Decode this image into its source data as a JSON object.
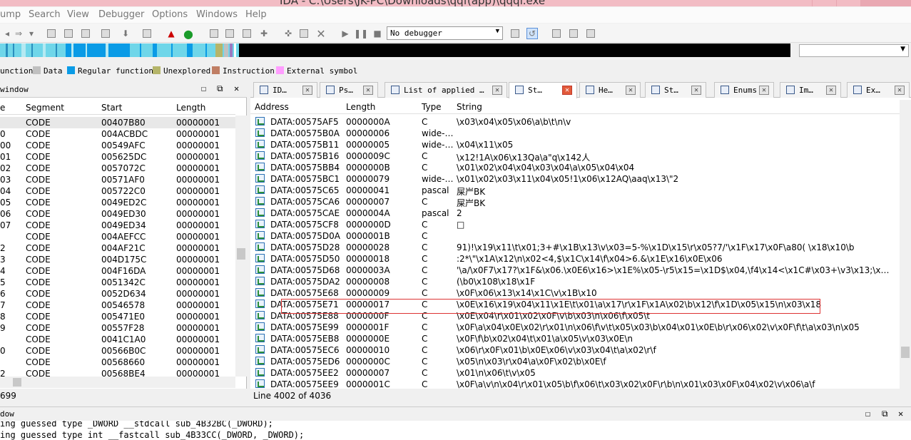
{
  "title": "IDA - C:\\Users\\JK-PC\\Downloads\\qqf(app)\\qqqf.exe",
  "menu": [
    "ump",
    "Search",
    "View",
    "Debugger",
    "Options",
    "Windows",
    "Help"
  ],
  "toolbar": {
    "debugger_select": "No debugger"
  },
  "legend": [
    {
      "label": "unction",
      "color": "#ffffff"
    },
    {
      "label": "Data",
      "color": "#c0c0c0"
    },
    {
      "label": "Regular function",
      "color": "#0a9be6"
    },
    {
      "label": "Unexplored",
      "color": "#b5b56a"
    },
    {
      "label": "Instruction",
      "color": "#c07e64"
    },
    {
      "label": "External symbol",
      "color": "#ff9eff"
    }
  ],
  "left_pane": {
    "title": "window",
    "columns": [
      "e",
      "Segment",
      "Start",
      "Length"
    ],
    "rows": [
      [
        "",
        "CODE",
        "00407B80",
        "00000001"
      ],
      [
        "0",
        "CODE",
        "004ACBDC",
        "00000001"
      ],
      [
        "00",
        "CODE",
        "00549AFC",
        "00000001"
      ],
      [
        "01",
        "CODE",
        "005625DC",
        "00000001"
      ],
      [
        "02",
        "CODE",
        "0057072C",
        "00000001"
      ],
      [
        "03",
        "CODE",
        "00571AF0",
        "00000001"
      ],
      [
        "04",
        "CODE",
        "005722C0",
        "00000001"
      ],
      [
        "05",
        "CODE",
        "0049ED2C",
        "00000001"
      ],
      [
        "06",
        "CODE",
        "0049ED30",
        "00000001"
      ],
      [
        "07",
        "CODE",
        "0049ED34",
        "00000001"
      ],
      [
        "",
        "CODE",
        "004AEFCC",
        "00000001"
      ],
      [
        "2",
        "CODE",
        "004AF21C",
        "00000001"
      ],
      [
        "3",
        "CODE",
        "004D175C",
        "00000001"
      ],
      [
        "4",
        "CODE",
        "004F16DA",
        "00000001"
      ],
      [
        "5",
        "CODE",
        "0051342C",
        "00000001"
      ],
      [
        "6",
        "CODE",
        "0052D634",
        "00000001"
      ],
      [
        "7",
        "CODE",
        "00546578",
        "00000001"
      ],
      [
        "8",
        "CODE",
        "005471E0",
        "00000001"
      ],
      [
        "9",
        "CODE",
        "00557F28",
        "00000001"
      ],
      [
        "",
        "CODE",
        "0041C1A0",
        "00000001"
      ],
      [
        "0",
        "CODE",
        "00566B0C",
        "00000001"
      ],
      [
        "",
        "CODE",
        "00568660",
        "00000001"
      ],
      [
        "2",
        "CODE",
        "00568BE4",
        "00000001"
      ]
    ],
    "status": "699"
  },
  "tabs": [
    {
      "label": "ID…",
      "active": false
    },
    {
      "label": "Ps…",
      "active": false
    },
    {
      "label": "List of applied …",
      "active": false
    },
    {
      "label": "St…",
      "active": true
    },
    {
      "label": "He…",
      "active": false
    },
    {
      "label": "St…",
      "active": false
    },
    {
      "label": "Enums",
      "active": false
    },
    {
      "label": "Im…",
      "active": false
    },
    {
      "label": "Ex…",
      "active": false
    }
  ],
  "strings_view": {
    "columns": [
      "Address",
      "Length",
      "Type",
      "String"
    ],
    "rows": [
      [
        "DATA:00575AF5",
        "0000000A",
        "C",
        "\\x03\\x04\\x05\\x06\\a\\b\\t\\n\\v"
      ],
      [
        "DATA:00575B0A",
        "00000006",
        "wide-…",
        ""
      ],
      [
        "DATA:00575B11",
        "00000005",
        "wide-…",
        "\\x04\\x11\\x05"
      ],
      [
        "DATA:00575B16",
        "0000009C",
        "C",
        "\\x12!1A\\x06\\x13Qa\\a\"q\\x142人"
      ],
      [
        "DATA:00575BB4",
        "0000000B",
        "C",
        "\\x01\\x02\\x04\\x04\\x03\\x04\\a\\x05\\x04\\x04"
      ],
      [
        "DATA:00575BC1",
        "00000079",
        "wide-…",
        "\\x01\\x02\\x03\\x11\\x04\\x05!1\\x06\\x12AQ\\aaq\\x13\\\"2"
      ],
      [
        "DATA:00575C65",
        "00000041",
        "pascal",
        "屎屵BK"
      ],
      [
        "DATA:00575CA6",
        "00000007",
        "C",
        "屎屵BK"
      ],
      [
        "DATA:00575CAE",
        "0000004A",
        "pascal",
        "2"
      ],
      [
        "DATA:00575CF8",
        "0000000D",
        "C",
        "□"
      ],
      [
        "DATA:00575D0A",
        "0000001B",
        "C",
        ""
      ],
      [
        "DATA:00575D28",
        "00000028",
        "C",
        "91)!\\x19\\x11\\t\\x01;3+#\\x1B\\x13\\v\\x03=5-%\\x1D\\x15\\r\\x05?7/'\\x1F\\x17\\x0F\\a80( \\x18\\x10\\b"
      ],
      [
        "DATA:00575D50",
        "00000018",
        "C",
        ":2*\\\"\\x1A\\x12\\n\\x02<4,$\\x1C\\x14\\f\\x04>6.&\\x1E\\x16\\x0E\\x06"
      ],
      [
        "DATA:00575D68",
        "0000003A",
        "C",
        "'\\a/\\x0F7\\x17?\\x1F&\\x06.\\x0E6\\x16>\\x1E%\\x05-\\r5\\x15=\\x1D$\\x04,\\f4\\x14<\\x1C#\\x03+\\v3\\x13;\\x…"
      ],
      [
        "DATA:00575DA2",
        "00000008",
        "C",
        "(\\b0\\x108\\x18\\x1F"
      ],
      [
        "DATA:00575E68",
        "00000009",
        "C",
        "\\x0F\\x06\\x13\\x14\\x1C\\v\\x1B\\x10"
      ],
      [
        "DATA:00575E71",
        "00000017",
        "C",
        "\\x0E\\x16\\x19\\x04\\x11\\x1E\\t\\x01\\a\\x17\\r\\x1F\\x1A\\x02\\b\\x12\\f\\x1D\\x05\\x15\\n\\x03\\x18"
      ],
      [
        "DATA:00575E88",
        "0000000F",
        "C",
        "\\x0E\\x04\\r\\x01\\x02\\x0F\\v\\b\\x03\\n\\x06\\f\\x05\\t"
      ],
      [
        "DATA:00575E99",
        "0000001F",
        "C",
        "\\x0F\\a\\x04\\x0E\\x02\\r\\x01\\n\\x06\\f\\v\\t\\x05\\x03\\b\\x04\\x01\\x0E\\b\\r\\x06\\x02\\v\\x0F\\f\\t\\a\\x03\\n\\x05"
      ],
      [
        "DATA:00575EB8",
        "0000000E",
        "C",
        "\\x0F\\f\\b\\x02\\x04\\t\\x01\\a\\x05\\v\\x03\\x0E\\n"
      ],
      [
        "DATA:00575EC6",
        "00000010",
        "C",
        "\\x06\\r\\x0F\\x01\\b\\x0E\\x06\\v\\x03\\x04\\t\\a\\x02\\r\\f"
      ],
      [
        "DATA:00575ED6",
        "0000000C",
        "C",
        "\\x05\\n\\x03\\r\\x04\\a\\x0F\\x02\\b\\x0E\\f"
      ],
      [
        "DATA:00575EE2",
        "00000007",
        "C",
        "\\x01\\n\\x06\\t\\v\\x05"
      ],
      [
        "DATA:00575EE9",
        "0000001C",
        "C",
        "\\x0F\\a\\v\\n\\x04\\r\\x01\\x05\\b\\f\\x06\\t\\x03\\x02\\x0F\\r\\b\\n\\x01\\x03\\x0F\\x04\\x02\\v\\x06\\a\\f"
      ]
    ],
    "status": "Line 4002 of 4036"
  },
  "output": {
    "title": "dow",
    "lines": [
      "ing guessed type _DWORD __stdcall sub_4B32BC(_DWORD);",
      "ing guessed type int __fastcall sub_4B33CC(_DWORD, _DWORD);"
    ]
  }
}
